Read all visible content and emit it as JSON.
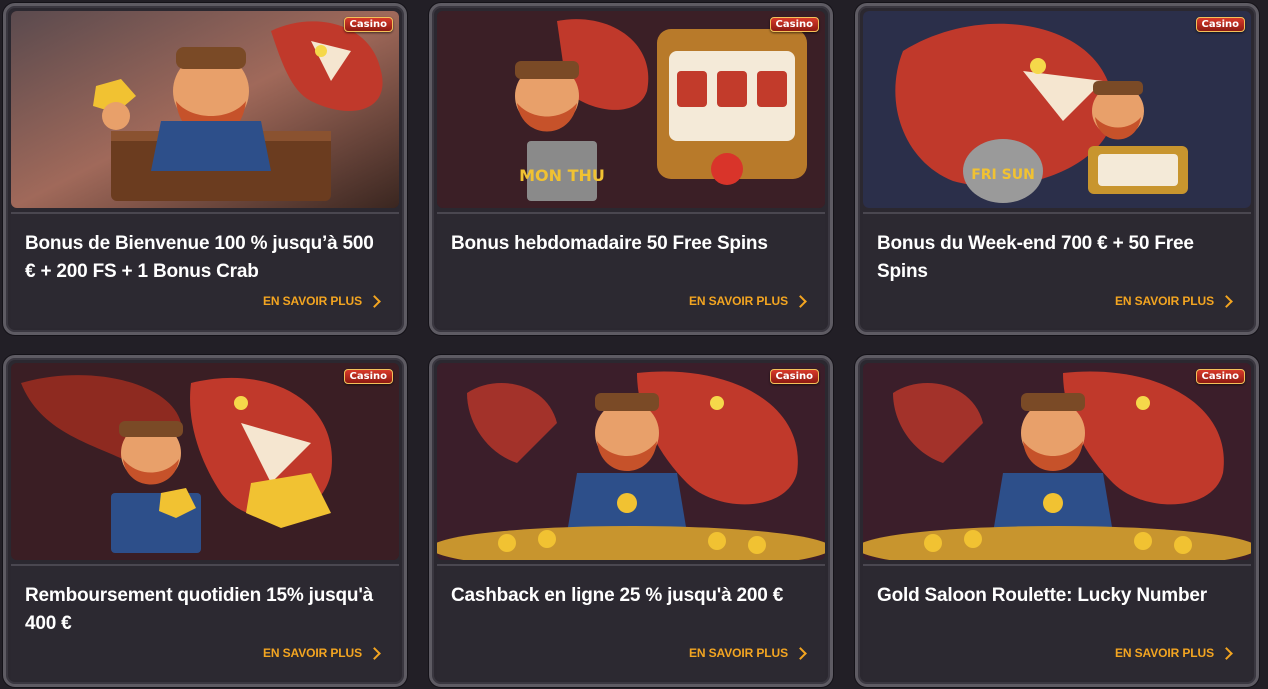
{
  "promotions": [
    {
      "title": "Bonus de Bienvenue 100 % jusqu’à 500 € + 200 FS + 1 Bonus Crab",
      "badge": "Casino",
      "cta": "EN SAVOIR PLUS",
      "art_label": ""
    },
    {
      "title": "Bonus hebdomadaire 50 Free Spins",
      "badge": "Casino",
      "cta": "EN SAVOIR PLUS",
      "art_label": "MON THU"
    },
    {
      "title": "Bonus du Week-end 700 € + 50 Free Spins",
      "badge": "Casino",
      "cta": "EN SAVOIR PLUS",
      "art_label": "FRI SUN"
    },
    {
      "title": "Remboursement quotidien 15% jusqu'à 400 €",
      "badge": "Casino",
      "cta": "EN SAVOIR PLUS",
      "art_label": ""
    },
    {
      "title": "Cashback en ligne 25 % jusqu'à 200 €",
      "badge": "Casino",
      "cta": "EN SAVOIR PLUS",
      "art_label": ""
    },
    {
      "title": "Gold Saloon Roulette: Lucky Number",
      "badge": "Casino",
      "cta": "EN SAVOIR PLUS",
      "art_label": ""
    }
  ],
  "colors": {
    "accent": "#f3a521",
    "background": "#221f26",
    "card": "#2c2931",
    "dragon": "#c0392b",
    "gold": "#f1c232"
  }
}
